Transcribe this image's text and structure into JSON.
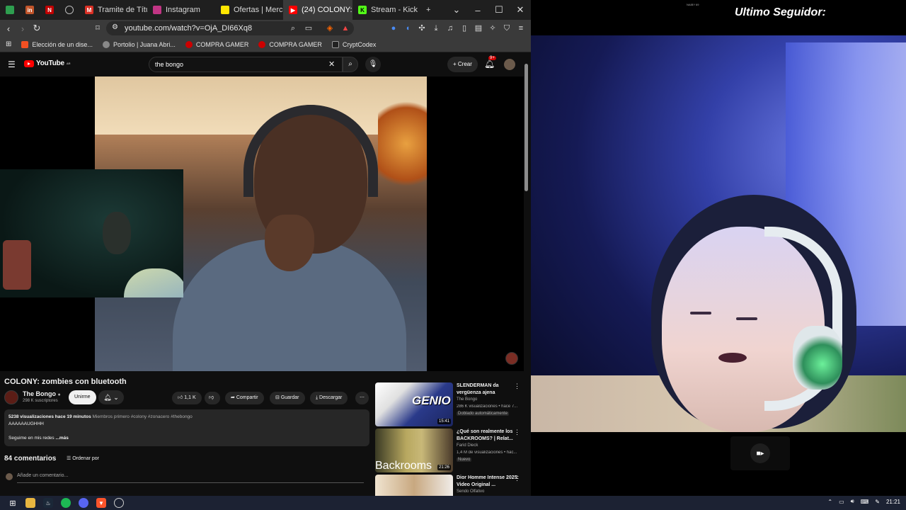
{
  "browser": {
    "tabs": [
      {
        "label": "",
        "icon": "green-app-icon",
        "color": "#2e9e4f"
      },
      {
        "label": "",
        "icon": "in-app-icon",
        "color": "#c0542a"
      },
      {
        "label": "",
        "icon": "netflix-icon",
        "color": "#c00000"
      },
      {
        "label": "",
        "icon": "settings-icon",
        "color": "#555555"
      },
      {
        "label": "Tramite de Título T",
        "icon": "gmail-icon",
        "color": "#d93025"
      },
      {
        "label": "Instagram",
        "icon": "instagram-icon",
        "color": "#c13584"
      },
      {
        "label": "Ofertas | Mercado",
        "icon": "mercadolibre-icon",
        "color": "#ffe600"
      },
      {
        "label": "(24) COLONY:",
        "icon": "youtube-icon",
        "color": "#ff0000",
        "active": true
      },
      {
        "label": "Stream - Kick Das",
        "icon": "kick-icon",
        "color": "#53fc18"
      }
    ],
    "url": "youtube.com/watch?v=OjA_DI66Xq8",
    "bookmarks": [
      {
        "label": "Elección de un dise...",
        "color": "#f25022"
      },
      {
        "label": "Portolio | Juana Abri...",
        "color": "#888888"
      },
      {
        "label": "COMPRA GAMER",
        "color": "#cc0000"
      },
      {
        "label": "COMPRA GAMER",
        "color": "#cc0000"
      },
      {
        "label": "CryptCodex",
        "color": "#222222"
      }
    ]
  },
  "youtube": {
    "logo": "YouTube",
    "logo_sup": "AR",
    "search_value": "the bongo",
    "create_label": "Crear",
    "notif_count": "9+",
    "video_title": "COLONY: zombies con bluetooth",
    "channel": {
      "name": "The Bongo",
      "subs": "298 K suscriptores",
      "join": "Unirme"
    },
    "actions": {
      "likes": "1,1 K",
      "share": "Compartir",
      "save": "Guardar",
      "download": "Descargar"
    },
    "description": {
      "meta": "5238 visualizaciones  hace 19 minutos",
      "tags": "Miembros primero  #colony #zonacero #thebongo",
      "line1": "AAAAAAUGHHH",
      "line2": "Seguime en mis redes",
      "more": "...más"
    },
    "comments_count": "84 comentarios",
    "sort_label": "Ordenar por",
    "comment_placeholder": "Añade un comentario...",
    "recommendations": [
      {
        "title": "SLENDERMAN da vergüenza ajena",
        "channel": "The Bongo",
        "meta": "286 K visualizaciones • hace 7...",
        "badge": "Doblado automáticamente",
        "duration": "15:41",
        "thumb_text": "GENIO"
      },
      {
        "title": "¿Qué son realmente los BACKROOMS? | Relat...",
        "channel": "Farid Dieck",
        "meta": "1,4 M de visualizaciones • hac...",
        "badge": "Nuevo",
        "duration": "21:26",
        "thumb_text": "Backrooms"
      },
      {
        "title": "Dior Homme Intense 2025: Video Original ...",
        "channel": "Sendo Olfativo",
        "meta": "",
        "badge": "",
        "duration": "",
        "thumb_text": ""
      }
    ]
  },
  "stream": {
    "tiny_label": "NAIBY 69",
    "heading": "Ultimo Seguidor:"
  },
  "taskbar": {
    "time": "21:21"
  }
}
